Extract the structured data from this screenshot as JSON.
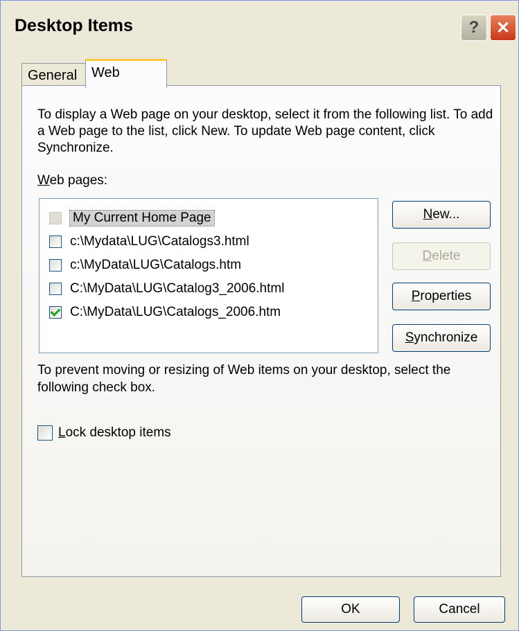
{
  "window": {
    "title": "Desktop Items",
    "help_glyph": "?",
    "close_glyph": "✕"
  },
  "tabs": [
    {
      "label": "General",
      "active": false
    },
    {
      "label": "Web",
      "active": true
    }
  ],
  "web": {
    "description": "To display a Web page on your desktop, select it from the following list. To add a Web page to the list, click New.  To update Web page content, click Synchronize.",
    "list_label_accel": "W",
    "list_label_rest": "eb pages:",
    "items": [
      {
        "label": "My Current Home Page",
        "checked": false,
        "disabled": true,
        "selected": true
      },
      {
        "label": "c:\\Mydata\\LUG\\Catalogs3.html",
        "checked": false
      },
      {
        "label": "c:\\MyData\\LUG\\Catalogs.htm",
        "checked": false
      },
      {
        "label": "C:\\MyData\\LUG\\Catalog3_2006.html",
        "checked": false
      },
      {
        "label": "C:\\MyData\\LUG\\Catalogs_2006.htm",
        "checked": true
      }
    ],
    "buttons": {
      "new_accel": "N",
      "new_rest": "ew...",
      "delete_accel": "D",
      "delete_rest": "elete",
      "properties_accel": "P",
      "properties_rest": "roperties",
      "synchronize_accel": "S",
      "synchronize_rest": "ynchronize"
    },
    "lock_description": "To prevent moving or resizing of Web items on your desktop, select the following check box.",
    "lock_accel": "L",
    "lock_rest": "ock desktop items",
    "lock_checked": false
  },
  "footer": {
    "ok_label": "OK",
    "cancel_label": "Cancel"
  }
}
